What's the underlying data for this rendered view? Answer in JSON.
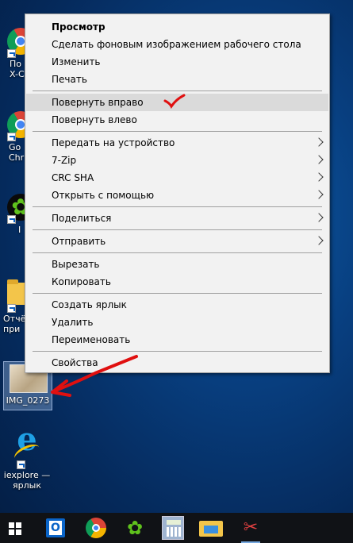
{
  "desktop": {
    "icons": [
      {
        "label": "По\nX-C",
        "icon": "chrome-icon"
      },
      {
        "label": "Go\nChr",
        "icon": "chrome-icon"
      },
      {
        "label": "I",
        "icon": "icq-icon"
      },
      {
        "label": "Отчё\nпри",
        "icon": "folder-icon"
      },
      {
        "label": "IMG_0273",
        "icon": "image-file-icon"
      },
      {
        "label": "iexplore —\nярлык",
        "icon": "internet-explorer-icon"
      }
    ]
  },
  "context_menu": {
    "items": [
      {
        "label": "Просмотр",
        "bold": true
      },
      {
        "label": "Сделать фоновым изображением рабочего стола"
      },
      {
        "label": "Изменить"
      },
      {
        "label": "Печать"
      },
      {
        "label": "Повернуть вправо",
        "highlighted": true
      },
      {
        "label": "Повернуть влево"
      },
      {
        "label": "Передать на устройство",
        "submenu": true
      },
      {
        "label": "7-Zip",
        "submenu": true
      },
      {
        "label": "CRC SHA",
        "submenu": true
      },
      {
        "label": "Открыть с помощью",
        "submenu": true
      },
      {
        "label": "Поделиться",
        "submenu": true
      },
      {
        "label": "Отправить",
        "submenu": true
      },
      {
        "label": "Вырезать"
      },
      {
        "label": "Копировать"
      },
      {
        "label": "Создать ярлык"
      },
      {
        "label": "Удалить"
      },
      {
        "label": "Переименовать"
      },
      {
        "label": "Свойства"
      }
    ]
  },
  "annotations": {
    "color": "#e01010",
    "marks": [
      "checkmark-annotation",
      "arrow-annotation"
    ]
  },
  "taskbar": {
    "items": [
      "start-button",
      "outlook-icon",
      "chrome-icon",
      "icq-icon",
      "calculator-icon",
      "file-explorer-icon",
      "snipping-tool-icon"
    ]
  },
  "colors": {
    "menu_bg": "#f2f2f2",
    "menu_hover": "#dadada",
    "taskbar_bg": "#101216",
    "desktop_bg": "#083f80"
  }
}
